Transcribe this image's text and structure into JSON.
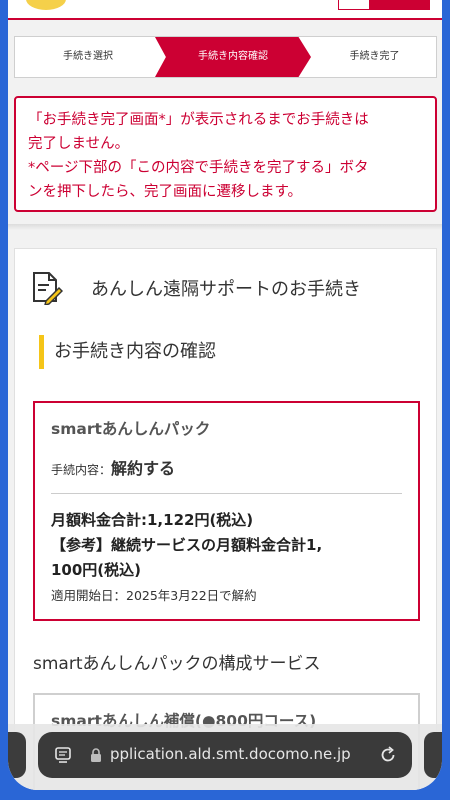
{
  "stepper": {
    "steps": [
      {
        "label": "手続き選択"
      },
      {
        "label": "手続き内容確認"
      },
      {
        "label": "手続き完了"
      }
    ]
  },
  "notice": {
    "line1": "「お手続き完了画面*」が表示されるまでお手続きは",
    "line2": "完了しません。",
    "line3": "*ページ下部の「この内容で手続きを完了する」ボタ",
    "line4": "ンを押下したら、完了画面に遷移します。"
  },
  "main": {
    "page_title": "あんしん遠隔サポートのお手続き",
    "section_heading": "お手続き内容の確認",
    "pack": {
      "name": "smartあんしんパック",
      "procedure_label": "手続内容：",
      "procedure_value": "解約する",
      "monthly_total": "月額料金合計:1,122円(税込)",
      "reference_line1": "【参考】継続サービスの月額料金合計1,",
      "reference_line2": "100円(税込)",
      "effective_note": "適用開始日：2025年3月22日で解約"
    },
    "components_title": "smartあんしんパックの構成サービス",
    "component_item": "smartあんしん補償(●800円コース)"
  },
  "browser": {
    "url": "pplication.ald.smt.docomo.ne.jp"
  },
  "colors": {
    "accent": "#cc0033",
    "heading_bar": "#f5c518",
    "background": "#2a66d6"
  }
}
